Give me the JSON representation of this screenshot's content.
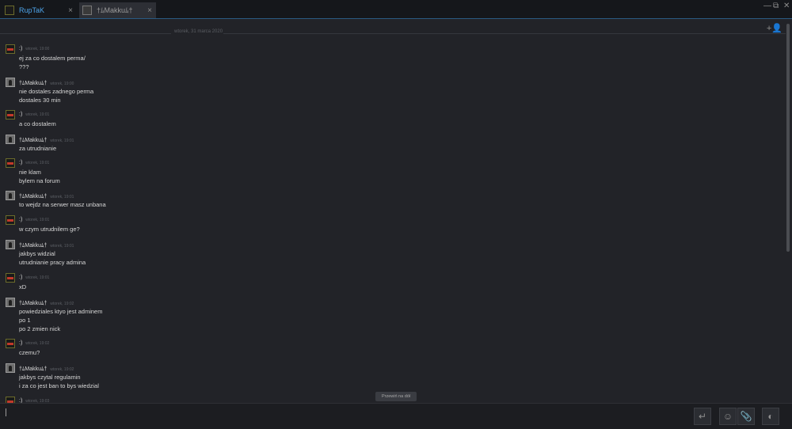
{
  "tabs": [
    {
      "label": "RupTaK",
      "close": "×"
    },
    {
      "label": "†ﾑMakkuﾑ†",
      "close": "×"
    }
  ],
  "window_controls": {
    "minimize": "—",
    "restore": "⧉",
    "close": "✕"
  },
  "chat": {
    "date_separator": "wtorek, 31 marca 2020",
    "add_user_icon": "+👤",
    "jump_button": "Przewiń na dół",
    "messages": [
      {
        "avatar": "rup",
        "name": ":)",
        "time": "wtorek, 19:00",
        "lines": [
          "ej za co dostalem perma/",
          "???"
        ]
      },
      {
        "avatar": "mak",
        "name": "†ﾑMakkuﾑ†",
        "time": "wtorek, 19:00",
        "lines": [
          "nie dostales zadnego perma",
          "dostales 30 min"
        ]
      },
      {
        "avatar": "rup",
        "name": ":)",
        "time": "wtorek, 19:01",
        "lines": [
          "a co dostalem"
        ]
      },
      {
        "avatar": "mak",
        "name": "†ﾑMakkuﾑ†",
        "time": "wtorek, 19:01",
        "lines": [
          "za utrudnianie"
        ]
      },
      {
        "avatar": "rup",
        "name": ":)",
        "time": "wtorek, 19:01",
        "lines": [
          "nie klam",
          "bylem na forum"
        ]
      },
      {
        "avatar": "mak",
        "name": "†ﾑMakkuﾑ†",
        "time": "wtorek, 19:01",
        "lines": [
          "to wejdz na serwer masz unbana"
        ]
      },
      {
        "avatar": "rup",
        "name": ":)",
        "time": "wtorek, 19:01",
        "lines": [
          "w czym utrudnilem ge?"
        ]
      },
      {
        "avatar": "mak",
        "name": "†ﾑMakkuﾑ†",
        "time": "wtorek, 19:01",
        "lines": [
          "jakbys widzial",
          "utrudnianie pracy admina"
        ]
      },
      {
        "avatar": "rup",
        "name": ":)",
        "time": "wtorek, 19:01",
        "lines": [
          "xD"
        ]
      },
      {
        "avatar": "mak",
        "name": "†ﾑMakkuﾑ†",
        "time": "wtorek, 19:02",
        "lines": [
          "powiedziales ktyo jest adminem",
          "po 1",
          "po 2 zmien nick"
        ]
      },
      {
        "avatar": "rup",
        "name": ":)",
        "time": "wtorek, 19:02",
        "lines": [
          "czemu?"
        ]
      },
      {
        "avatar": "mak",
        "name": "†ﾑMakkuﾑ†",
        "time": "wtorek, 19:02",
        "lines": [
          "jakbys czytal regulamin",
          "i za co jest ban to bys wiedzial"
        ]
      },
      {
        "avatar": "rup",
        "name": ":)",
        "time": "wtorek, 19:03",
        "lines": []
      }
    ]
  },
  "input_bar": {
    "send_icon": "↵",
    "emoji_icon": "☺",
    "attach_icon": "📎",
    "voice_icon": "◐"
  }
}
